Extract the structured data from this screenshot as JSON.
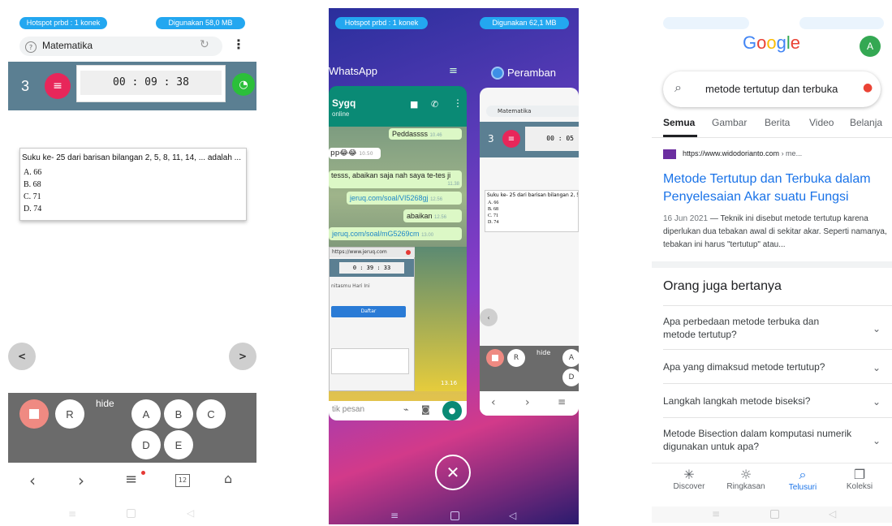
{
  "panel1": {
    "status": {
      "hotspot": "Hotspot prbd : 1 konek",
      "usage": "Digunakan 58,0 MB"
    },
    "browser": {
      "tab_title": "Matematika"
    },
    "quiz": {
      "question_number": "3",
      "timer": "00 : 09 : 38",
      "question": "Suku ke- 25 dari barisan bilangan 2, 5, 8, 11, 14, ... adalah ...",
      "options": [
        "A.  66",
        "B.  68",
        "C.  71",
        "D.  74"
      ],
      "prev": "<",
      "next": ">",
      "r_label": "R",
      "hide_label": "hide",
      "answers": [
        "A",
        "B",
        "C",
        "D",
        "E"
      ]
    },
    "nav": {
      "tabs_count": "12"
    }
  },
  "panel2": {
    "status": {
      "hotspot": "Hotspot prbd : 1 konek",
      "usage": "Digunakan 62,1 MB"
    },
    "whatsapp": {
      "app_label": "WhatsApp",
      "contact": "Sygq",
      "presence": "online",
      "messages": [
        {
          "text": "Peddassss",
          "time": "10.46"
        },
        {
          "text": "pp😂😂",
          "time": "10.50"
        },
        {
          "text": "tesss, abaikan saja nah saya te-tes ji",
          "time": "11.38"
        },
        {
          "text": "jeruq.com/soal/VI5268gj",
          "time": "12.56"
        },
        {
          "text": "abaikan",
          "time": "12.56"
        },
        {
          "text": "jeruq.com/soal/mG5269cm",
          "time": "13.00"
        }
      ],
      "input_placeholder": "tik pesan",
      "embedded": {
        "url": "https://www.jeruq.com",
        "timer": "0 : 39 : 33",
        "greeting": "nitasmu Hari Ini",
        "button": "Daftar",
        "time": "13.16"
      }
    },
    "browser_card": {
      "app_label": "Peramban",
      "tab_title": "Matematika",
      "qnum": "3",
      "timer": "00 : 05",
      "question": "Suku ke- 25 dari barisan bilangan 2, 5",
      "options": [
        "A.  66",
        "B.  68",
        "C.  71",
        "D.  74"
      ],
      "r_label": "R",
      "hide_label": "hide",
      "answers": [
        "A",
        "D"
      ]
    }
  },
  "panel3": {
    "logo": "Google",
    "avatar": "A",
    "query": "metode tertutup dan terbuka",
    "tabs": [
      "Semua",
      "Gambar",
      "Berita",
      "Video",
      "Belanja"
    ],
    "result": {
      "url": "https://www.widodorianto.com",
      "url_suffix": " › me...",
      "title": "Metode Tertutup dan Terbuka dalam Penyelesaian Akar suatu Fungsi",
      "date": "16 Jun 2021",
      "snippet": " — Teknik ini disebut metode tertutup karena diperlukan dua tebakan awal di sekitar akar. Seperti namanya, tebakan ini harus \"tertutup\" atau..."
    },
    "paa_title": "Orang juga bertanya",
    "paa": [
      "Apa perbedaan metode terbuka dan metode tertutup?",
      "Apa yang dimaksud metode tertutup?",
      "Langkah langkah metode biseksi?",
      "Metode Bisection dalam komputasi numerik digunakan untuk apa?"
    ],
    "bottom_nav": [
      "Discover",
      "Ringkasan",
      "Telusuri",
      "Koleksi"
    ]
  },
  "colors": {
    "accent_blue": "#23a7f0",
    "quiz_bar": "#5b7f92",
    "menu_pink": "#e8265a",
    "salmon": "#ef8a82",
    "google_link": "#1a0dab"
  }
}
